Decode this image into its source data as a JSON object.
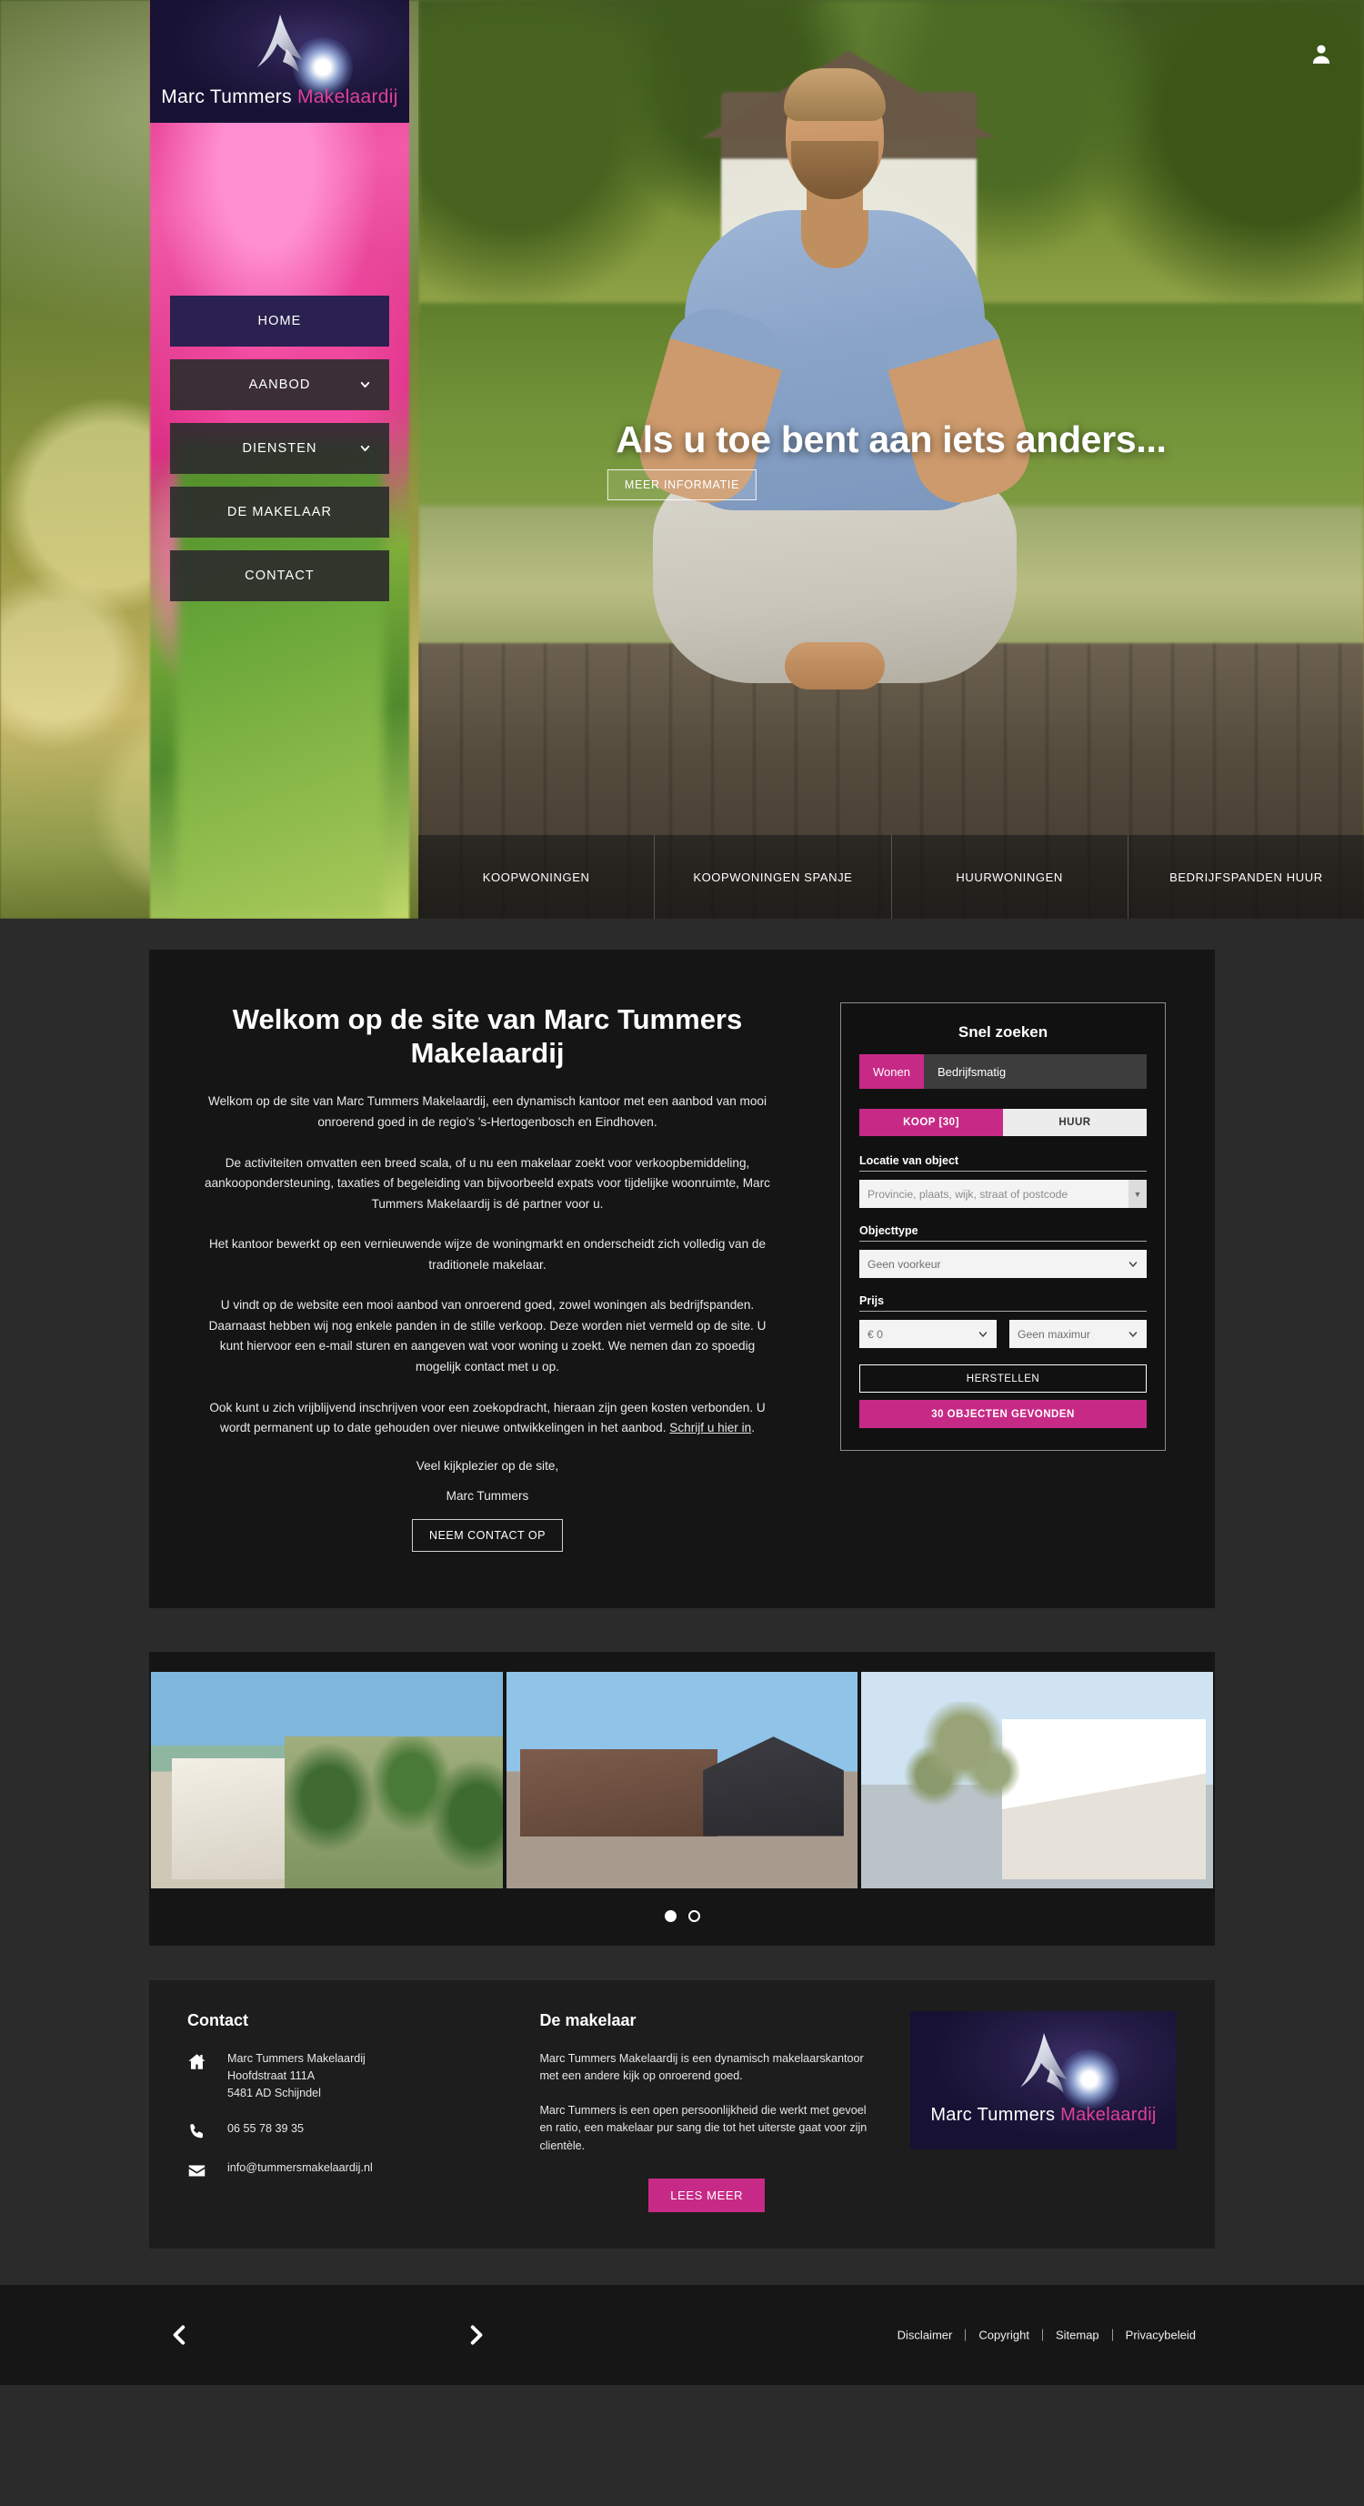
{
  "brand": {
    "name_part1": "Marc Tummers ",
    "name_part2": "Makelaardij",
    "accent_color": "#c72a86",
    "logo_bg_color": "#241c46"
  },
  "header": {
    "user_icon": "user-icon"
  },
  "nav": {
    "items": [
      {
        "label": "HOME",
        "active": true,
        "caret": false
      },
      {
        "label": "AANBOD",
        "active": false,
        "caret": true
      },
      {
        "label": "DIENSTEN",
        "active": false,
        "caret": true
      },
      {
        "label": "DE MAKELAAR",
        "active": false,
        "caret": false
      },
      {
        "label": "CONTACT",
        "active": false,
        "caret": false
      }
    ]
  },
  "hero": {
    "headline": "Als u toe bent aan iets anders...",
    "button_label": "MEER INFORMATIE",
    "categories": [
      {
        "label": "KOOPWONINGEN"
      },
      {
        "label": "KOOPWONINGEN SPANJE"
      },
      {
        "label": "HUURWONINGEN"
      },
      {
        "label": "BEDRIJFSPANDEN HUUR"
      }
    ]
  },
  "welcome": {
    "title": "Welkom op de site van Marc Tummers Makelaardij",
    "paragraphs": [
      "Welkom op de site van Marc Tummers Makelaardij, een dynamisch kantoor met een aanbod van mooi onroerend goed in de regio's 's-Hertogenbosch en Eindhoven.",
      "De activiteiten omvatten een breed scala, of u nu een makelaar zoekt voor verkoopbemiddeling, aankoopondersteuning, taxaties of begeleiding van bijvoorbeeld expats voor tijdelijke woonruimte, Marc Tummers Makelaardij is dé partner voor u.",
      "Het kantoor bewerkt op een vernieuwende wijze de woningmarkt en onderscheidt zich volledig van de traditionele makelaar.",
      "U vindt op de website een mooi aanbod van onroerend goed, zowel woningen als bedrijfspanden. Daarnaast hebben wij nog enkele panden in de stille verkoop. Deze worden niet vermeld op de site. U kunt hiervoor een e-mail sturen en aangeven wat voor woning u zoekt. We nemen dan zo spoedig mogelijk contact met u op."
    ],
    "paragraph_with_link": {
      "before": "Ook kunt u zich vrijblijvend inschrijven voor een zoekopdracht, hieraan zijn geen kosten verbonden. U wordt permanent up to date gehouden over nieuwe ontwikkelingen in het aanbod. ",
      "link": "Schrijf u hier in",
      "after": "."
    },
    "closing": "Veel kijkplezier op de site,",
    "signature": "Marc Tummers",
    "cta_label": "NEEM CONTACT OP"
  },
  "search": {
    "title": "Snel zoeken",
    "tabs": [
      {
        "label": "Wonen",
        "selected": true
      },
      {
        "label": "Bedrijfsmatig",
        "selected": false
      }
    ],
    "segments": [
      {
        "label": "KOOP [30]",
        "selected": true
      },
      {
        "label": "HUUR",
        "selected": false
      }
    ],
    "location_label": "Locatie van object",
    "location_placeholder": "Provincie, plaats, wijk, straat of postcode",
    "objecttype_label": "Objecttype",
    "objecttype_value": "Geen voorkeur",
    "price_label": "Prijs",
    "price_min_value": "€ 0",
    "price_max_value": "Geen maximur",
    "reset_label": "HERSTELLEN",
    "submit_label": "30 OBJECTEN GEVONDEN"
  },
  "carousel": {
    "slides": [
      {
        "alt": "Wit appartementencomplex met palmbomen aan zee"
      },
      {
        "alt": "Bedrijfspand met bakstenen gevel en glazen entree"
      },
      {
        "alt": "Moderne witte villa met olijfboom"
      }
    ],
    "dots": [
      {
        "active": true
      },
      {
        "active": false
      }
    ]
  },
  "footer_contact": {
    "title": "Contact",
    "address_icon": "home-icon",
    "address_lines": "Marc Tummers Makelaardij\nHoofdstraat 111A\n5481 AD Schijndel",
    "phone_icon": "phone-icon",
    "phone": "06 55 78 39 35",
    "email_icon": "envelope-icon",
    "email": "info@tummersmakelaardij.nl"
  },
  "footer_maker": {
    "title": "De makelaar",
    "paragraph1": "Marc Tummers Makelaardij is een dynamisch makelaarskantoor met een andere kijk op onroerend goed.",
    "paragraph2": "Marc Tummers is een open persoonlijkheid die werkt met gevoel en ratio, een makelaar pur sang die tot het uiterste gaat voor zijn clientèle.",
    "cta_label": "LEES MEER"
  },
  "bottom": {
    "prev_icon": "chevron-left-icon",
    "next_icon": "chevron-right-icon",
    "links": [
      {
        "label": "Disclaimer"
      },
      {
        "label": "Copyright"
      },
      {
        "label": "Sitemap"
      },
      {
        "label": "Privacybeleid"
      }
    ]
  }
}
